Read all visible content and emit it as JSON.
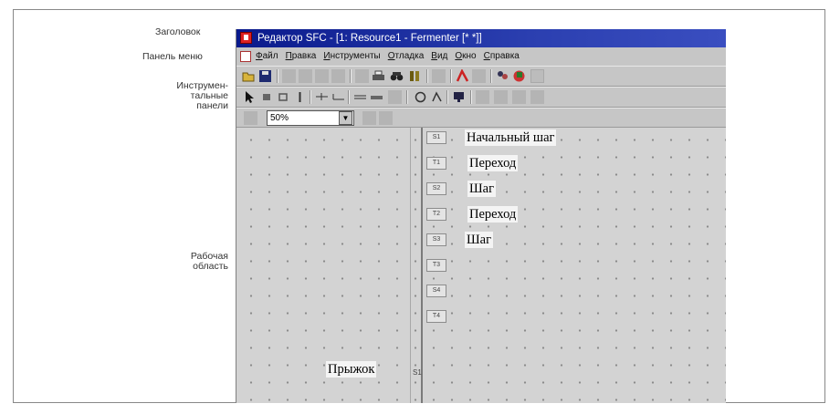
{
  "callouts": {
    "title": "Заголовок",
    "menu": "Панель меню",
    "toolbars_line1": "Инструмен-",
    "toolbars_line2": "тальные",
    "toolbars_line3": "панели",
    "work_line1": "Рабочая",
    "work_line2": "область"
  },
  "window": {
    "title": "Редактор SFC - [1: Resource1 - Fermenter [* *]]",
    "menu": [
      "Файл",
      "Правка",
      "Инструменты",
      "Отладка",
      "Вид",
      "Окно",
      "Справка"
    ],
    "zoom": "50%"
  },
  "diagram": {
    "nodes": [
      "S1",
      "T1",
      "S2",
      "T2",
      "S3",
      "T3",
      "S4",
      "T4"
    ],
    "labels": {
      "initial_step": "Начальный шаг",
      "transition1": "Переход",
      "step1": "Шаг",
      "transition2": "Переход",
      "step2": "Шаг",
      "jump": "Прыжок"
    },
    "jump_target": "S1"
  }
}
